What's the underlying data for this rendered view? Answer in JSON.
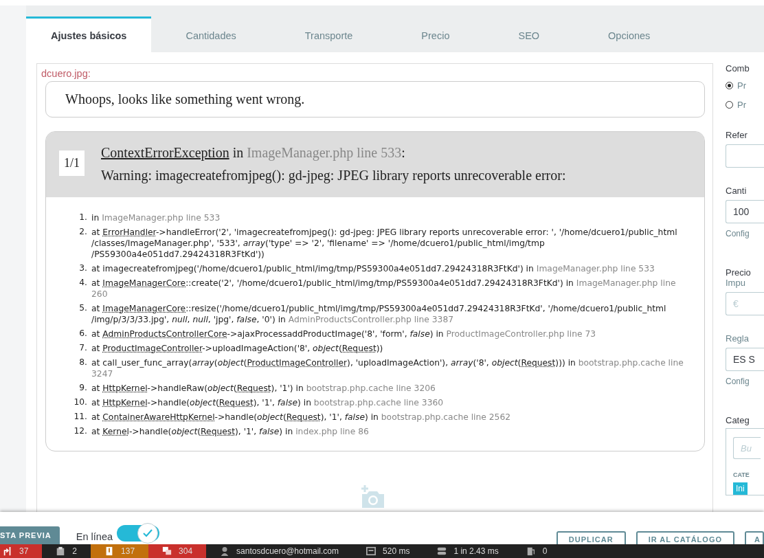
{
  "tabs": [
    {
      "label": "Ajustes básicos",
      "selected": true
    },
    {
      "label": "Cantidades",
      "selected": false
    },
    {
      "label": "Transporte",
      "selected": false
    },
    {
      "label": "Precio",
      "selected": false
    },
    {
      "label": "SEO",
      "selected": false
    },
    {
      "label": "Opciones",
      "selected": false
    }
  ],
  "upload_error": {
    "filename": "dcuero.jpg:",
    "message": "Whoops, looks like something went wrong.",
    "exception": {
      "counter": "1/1",
      "title": [
        {
          "kind": "class",
          "text": "ContextErrorException"
        },
        {
          "kind": "text",
          "text": " in "
        },
        {
          "kind": "file",
          "text": "ImageManager.php line 533"
        },
        {
          "kind": "text",
          "text": ":"
        }
      ],
      "warning": "Warning: imagecreatefromjpeg(): gd-jpeg: JPEG library reports unrecoverable error:",
      "trace": [
        {
          "number": "1.",
          "parts": [
            {
              "kind": "text",
              "text": "in "
            },
            {
              "kind": "file",
              "text": "ImageManager.php line 533"
            }
          ]
        },
        {
          "number": "2.",
          "parts": [
            {
              "kind": "text",
              "text": "at "
            },
            {
              "kind": "class",
              "text": "ErrorHandler"
            },
            {
              "kind": "text",
              "text": "->handleError('2', 'imagecreatefromjpeg(): gd-jpeg: JPEG library reports unrecoverable error: ', '/home/dcuero1/public_html /classes/ImageManager.php', '533', "
            },
            {
              "kind": "italic",
              "text": "array"
            },
            {
              "kind": "text",
              "text": "('type' => '2', 'filename' => '/home/dcuero1/public_html/img/tmp /PS59300a4e051dd7.29424318R3FtKd'))"
            }
          ]
        },
        {
          "number": "3.",
          "parts": [
            {
              "kind": "text",
              "text": "at imagecreatefromjpeg('/home/dcuero1/public_html/img/tmp/PS59300a4e051dd7.29424318R3FtKd') in "
            },
            {
              "kind": "file",
              "text": "ImageManager.php line 533"
            }
          ]
        },
        {
          "number": "4.",
          "parts": [
            {
              "kind": "text",
              "text": "at "
            },
            {
              "kind": "class",
              "text": "ImageManagerCore"
            },
            {
              "kind": "text",
              "text": "::create('2', '/home/dcuero1/public_html/img/tmp/PS59300a4e051dd7.29424318R3FtKd') in "
            },
            {
              "kind": "file",
              "text": "ImageManager.php line 260"
            }
          ]
        },
        {
          "number": "5.",
          "parts": [
            {
              "kind": "text",
              "text": "at "
            },
            {
              "kind": "class",
              "text": "ImageManagerCore"
            },
            {
              "kind": "text",
              "text": "::resize('/home/dcuero1/public_html/img/tmp/PS59300a4e051dd7.29424318R3FtKd', '/home/dcuero1/public_html /img/p/3/3/33.jpg', "
            },
            {
              "kind": "italic",
              "text": "null"
            },
            {
              "kind": "text",
              "text": ", "
            },
            {
              "kind": "italic",
              "text": "null"
            },
            {
              "kind": "text",
              "text": ", 'jpg', "
            },
            {
              "kind": "italic",
              "text": "false"
            },
            {
              "kind": "text",
              "text": ", '0') in "
            },
            {
              "kind": "file",
              "text": "AdminProductsController.php line 3387"
            }
          ]
        },
        {
          "number": "6.",
          "parts": [
            {
              "kind": "text",
              "text": "at "
            },
            {
              "kind": "class",
              "text": "AdminProductsControllerCore"
            },
            {
              "kind": "text",
              "text": "->ajaxProcessaddProductImage('8', 'form', "
            },
            {
              "kind": "italic",
              "text": "false"
            },
            {
              "kind": "text",
              "text": ") in "
            },
            {
              "kind": "file",
              "text": "ProductImageController.php line 73"
            }
          ]
        },
        {
          "number": "7.",
          "parts": [
            {
              "kind": "text",
              "text": "at "
            },
            {
              "kind": "class",
              "text": "ProductImageController"
            },
            {
              "kind": "text",
              "text": "->uploadImageAction('8', "
            },
            {
              "kind": "italic",
              "text": "object"
            },
            {
              "kind": "text",
              "text": "("
            },
            {
              "kind": "class",
              "text": "Request"
            },
            {
              "kind": "text",
              "text": "))"
            }
          ]
        },
        {
          "number": "8.",
          "parts": [
            {
              "kind": "text",
              "text": "at call_user_func_array("
            },
            {
              "kind": "italic",
              "text": "array"
            },
            {
              "kind": "text",
              "text": "("
            },
            {
              "kind": "italic",
              "text": "object"
            },
            {
              "kind": "text",
              "text": "("
            },
            {
              "kind": "class",
              "text": "ProductImageController"
            },
            {
              "kind": "text",
              "text": "), 'uploadImageAction'), "
            },
            {
              "kind": "italic",
              "text": "array"
            },
            {
              "kind": "text",
              "text": "('8', "
            },
            {
              "kind": "italic",
              "text": "object"
            },
            {
              "kind": "text",
              "text": "("
            },
            {
              "kind": "class",
              "text": "Request"
            },
            {
              "kind": "text",
              "text": "))) in "
            },
            {
              "kind": "file",
              "text": "bootstrap.php.cache line 3247"
            }
          ]
        },
        {
          "number": "9.",
          "parts": [
            {
              "kind": "text",
              "text": "at "
            },
            {
              "kind": "class",
              "text": "HttpKernel"
            },
            {
              "kind": "text",
              "text": "->handleRaw("
            },
            {
              "kind": "italic",
              "text": "object"
            },
            {
              "kind": "text",
              "text": "("
            },
            {
              "kind": "class",
              "text": "Request"
            },
            {
              "kind": "text",
              "text": "), '1') in "
            },
            {
              "kind": "file",
              "text": "bootstrap.php.cache line 3206"
            }
          ]
        },
        {
          "number": "10.",
          "parts": [
            {
              "kind": "text",
              "text": "at "
            },
            {
              "kind": "class",
              "text": "HttpKernel"
            },
            {
              "kind": "text",
              "text": "->handle("
            },
            {
              "kind": "italic",
              "text": "object"
            },
            {
              "kind": "text",
              "text": "("
            },
            {
              "kind": "class",
              "text": "Request"
            },
            {
              "kind": "text",
              "text": "), '1', "
            },
            {
              "kind": "italic",
              "text": "false"
            },
            {
              "kind": "text",
              "text": ") in "
            },
            {
              "kind": "file",
              "text": "bootstrap.php.cache line 3360"
            }
          ]
        },
        {
          "number": "11.",
          "parts": [
            {
              "kind": "text",
              "text": "at "
            },
            {
              "kind": "class",
              "text": "ContainerAwareHttpKernel"
            },
            {
              "kind": "text",
              "text": "->handle("
            },
            {
              "kind": "italic",
              "text": "object"
            },
            {
              "kind": "text",
              "text": "("
            },
            {
              "kind": "class",
              "text": "Request"
            },
            {
              "kind": "text",
              "text": "), '1', "
            },
            {
              "kind": "italic",
              "text": "false"
            },
            {
              "kind": "text",
              "text": ") in "
            },
            {
              "kind": "file",
              "text": "bootstrap.php.cache line 2562"
            }
          ]
        },
        {
          "number": "12.",
          "parts": [
            {
              "kind": "text",
              "text": "at "
            },
            {
              "kind": "class",
              "text": "Kernel"
            },
            {
              "kind": "text",
              "text": "->handle("
            },
            {
              "kind": "italic",
              "text": "object"
            },
            {
              "kind": "text",
              "text": "("
            },
            {
              "kind": "class",
              "text": "Request"
            },
            {
              "kind": "text",
              "text": "), '1', "
            },
            {
              "kind": "italic",
              "text": "false"
            },
            {
              "kind": "text",
              "text": ") in "
            },
            {
              "kind": "file",
              "text": "index.php line 86"
            }
          ]
        }
      ]
    }
  },
  "side_panel": {
    "combinations_label": "Comb",
    "radios": [
      {
        "label": "Pr",
        "selected": true
      },
      {
        "label": "Pr",
        "selected": false
      }
    ],
    "reference_label": "Refer",
    "quantity_label": "Canti",
    "quantity_value": "100",
    "quantity_link": "Config",
    "price_label": "Precio",
    "tax_label": "Impu",
    "price_placeholder": "€",
    "tax_rule_label": "Regla",
    "tax_rule_value": "ES S",
    "tax_rule_link": "Config",
    "categories_label": "Categ",
    "category_search_placeholder": "Bu",
    "categories_heading": "CATE",
    "category_chip": "Ini"
  },
  "footer": {
    "preview_button": "STA PREVIA",
    "online_label": "En línea",
    "online": true,
    "buttons": [
      "DUPLICAR",
      "IR AL CATÁLOGO",
      "A"
    ]
  },
  "debug_bar": [
    {
      "kind": "routes",
      "text": "37",
      "color": "#c9302c"
    },
    {
      "kind": "clipboard",
      "text": "2",
      "color": "#222222"
    },
    {
      "kind": "warning",
      "text": "137",
      "color": "#c2700d"
    },
    {
      "kind": "messages",
      "text": "304",
      "color": "#c9302c"
    },
    {
      "kind": "user",
      "text": "santosdcuero@hotmail.com",
      "color": "#222222"
    },
    {
      "kind": "time",
      "text": "520 ms",
      "color": "#222222"
    },
    {
      "kind": "database",
      "text": "1 in 2.43 ms",
      "color": "#222222"
    },
    {
      "kind": "fuel",
      "text": "0",
      "color": "#222222"
    }
  ]
}
